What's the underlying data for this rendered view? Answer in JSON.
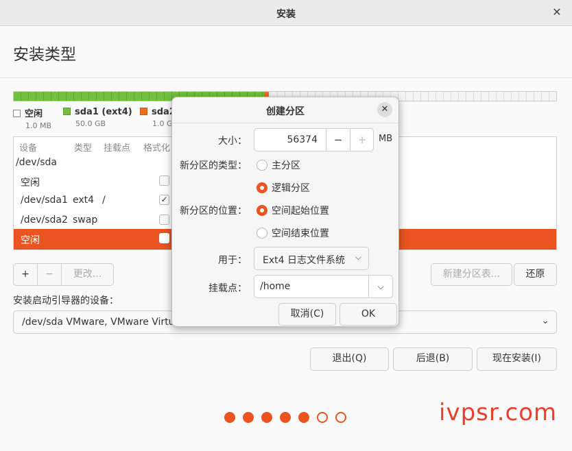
{
  "window": {
    "title": "安装",
    "close_icon": "close-icon"
  },
  "page": {
    "title": "安装类型"
  },
  "disk_bar": {
    "ext4_fraction": 0.4618,
    "swap_fraction": 0.0094,
    "ext4_color": "#73c03f",
    "swap_color": "#e8701f"
  },
  "legend": [
    {
      "name": "空闲",
      "size": "1.0 MB",
      "color": "#ffffff"
    },
    {
      "name": "sda1 (ext4)",
      "size": "50.0 GB",
      "color": "#73c03f"
    },
    {
      "name": "sda2",
      "size": "1.0 G",
      "color": "#e8701f"
    }
  ],
  "table": {
    "headers": {
      "device": "设备",
      "type": "类型",
      "mount": "挂载点",
      "format": "格式化"
    },
    "rows": [
      {
        "device": "/dev/sda",
        "type": "",
        "mount": ""
      },
      {
        "device": "空闲",
        "type": "",
        "mount": "",
        "checked": false
      },
      {
        "device": "/dev/sda1",
        "type": "ext4",
        "mount": "/",
        "checked": true
      },
      {
        "device": "/dev/sda2",
        "type": "swap",
        "mount": "",
        "checked": false
      },
      {
        "device": "空闲",
        "type": "",
        "mount": "",
        "checked": false,
        "selected": true
      }
    ]
  },
  "toolbar": {
    "add": "+",
    "remove": "−",
    "change": "更改...",
    "new_table": "新建分区表...",
    "revert": "还原"
  },
  "boot": {
    "label": "安装启动引导器的设备：",
    "value": "/dev/sda   VMware, VMware Virtu"
  },
  "actions": {
    "quit": "退出(Q)",
    "back": "后退(B)",
    "install_now": "现在安装(I)"
  },
  "progress": {
    "total_steps": 7,
    "completed_steps": 5
  },
  "watermark": "ivpsr.com",
  "dialog": {
    "title": "创建分区",
    "size_label": "大小：",
    "size_value": "56374",
    "size_unit": "MB",
    "minus": "−",
    "plus": "+",
    "type_label": "新分区的类型：",
    "type_primary": "主分区",
    "type_logical": "逻辑分区",
    "location_label": "新分区的位置：",
    "location_begin": "空间起始位置",
    "location_end": "空间结束位置",
    "use_as_label": "用于：",
    "use_as_value": "Ext4 日志文件系统",
    "mount_label": "挂载点：",
    "mount_value": "/home",
    "cancel": "取消(C)",
    "ok": "OK"
  }
}
